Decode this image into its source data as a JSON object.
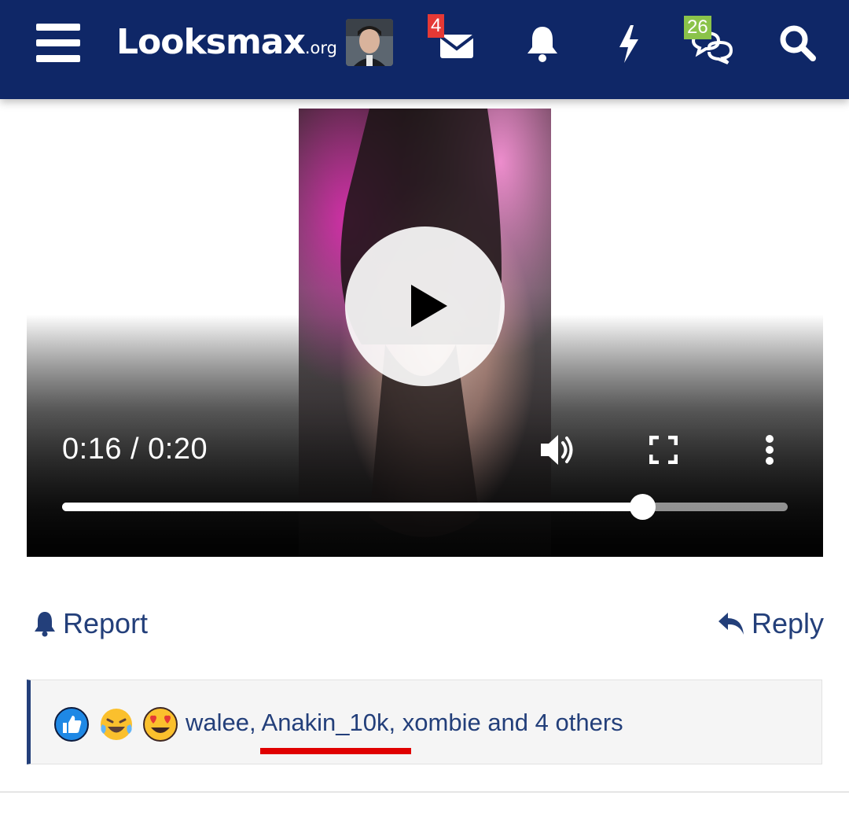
{
  "header": {
    "logo_main": "Looksmax",
    "logo_suffix": ".org",
    "inbox_badge": "4",
    "conversations_badge": "26",
    "icons": {
      "menu": "hamburger-menu-icon",
      "avatar": "user-avatar",
      "inbox": "envelope-icon",
      "alerts": "bell-icon",
      "whats_new": "lightning-icon",
      "conversations": "chat-bubbles-icon",
      "search": "search-icon"
    },
    "colors": {
      "bar": "#0f2767",
      "badge_red": "#e53935",
      "badge_green": "#8bc34a"
    }
  },
  "video": {
    "time_display": "0:16 / 0:20",
    "progress_fraction": 0.8,
    "icons": {
      "play": "play-icon",
      "volume": "volume-icon",
      "fullscreen": "fullscreen-icon",
      "more": "more-vertical-icon"
    }
  },
  "post_actions": {
    "report_label": "Report",
    "reply_label": "Reply"
  },
  "reactions": {
    "emojis": [
      "thumbs-up-icon",
      "laughing-crying-icon",
      "heart-eyes-icon"
    ],
    "users": [
      "walee",
      "Anakin_10k",
      "xombie"
    ],
    "separator": ", ",
    "and_text": " and ",
    "others_label": "4 others",
    "accent_color": "#233f7a",
    "highlight_color": "#e00000"
  }
}
